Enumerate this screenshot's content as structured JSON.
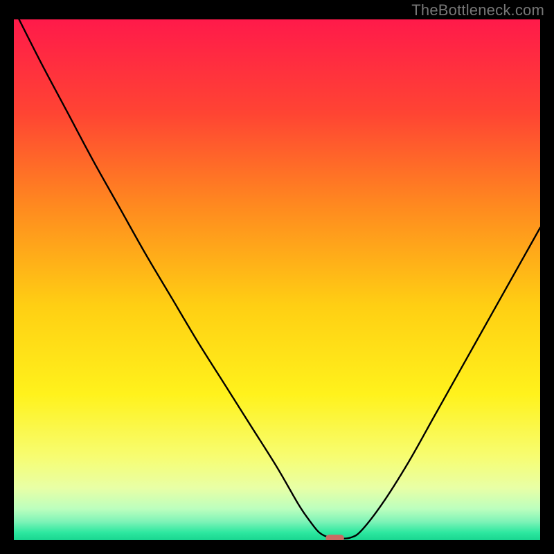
{
  "watermark": "TheBottleneck.com",
  "chart_data": {
    "type": "line",
    "title": "",
    "xlabel": "",
    "ylabel": "",
    "xlim": [
      0,
      100
    ],
    "ylim": [
      0,
      100
    ],
    "gradient_stops": [
      {
        "offset": 0.0,
        "color": "#ff1a4a"
      },
      {
        "offset": 0.18,
        "color": "#ff4433"
      },
      {
        "offset": 0.36,
        "color": "#ff8a1f"
      },
      {
        "offset": 0.55,
        "color": "#ffcf13"
      },
      {
        "offset": 0.72,
        "color": "#fff21c"
      },
      {
        "offset": 0.84,
        "color": "#f7fd72"
      },
      {
        "offset": 0.9,
        "color": "#e8ffa6"
      },
      {
        "offset": 0.94,
        "color": "#bcffbe"
      },
      {
        "offset": 0.965,
        "color": "#7cf3b7"
      },
      {
        "offset": 0.985,
        "color": "#2ee8a0"
      },
      {
        "offset": 1.0,
        "color": "#18d690"
      }
    ],
    "series": [
      {
        "name": "bottleneck-curve",
        "x": [
          0,
          5,
          10,
          15,
          20,
          25,
          30,
          35,
          40,
          45,
          50,
          54,
          56,
          58,
          60,
          62,
          64,
          66,
          70,
          75,
          80,
          85,
          90,
          95,
          100
        ],
        "y": [
          102,
          92,
          82.5,
          73,
          64,
          55,
          46.5,
          38,
          30,
          22,
          14,
          7,
          4,
          1.5,
          0.5,
          0.3,
          0.5,
          1.8,
          7,
          15,
          24,
          33,
          42,
          51,
          60
        ]
      }
    ],
    "marker": {
      "name": "optimal-marker",
      "x": 61,
      "y": 0.4,
      "width_pct": 3.5,
      "height_pct": 1.3,
      "color": "#c86b63"
    }
  }
}
